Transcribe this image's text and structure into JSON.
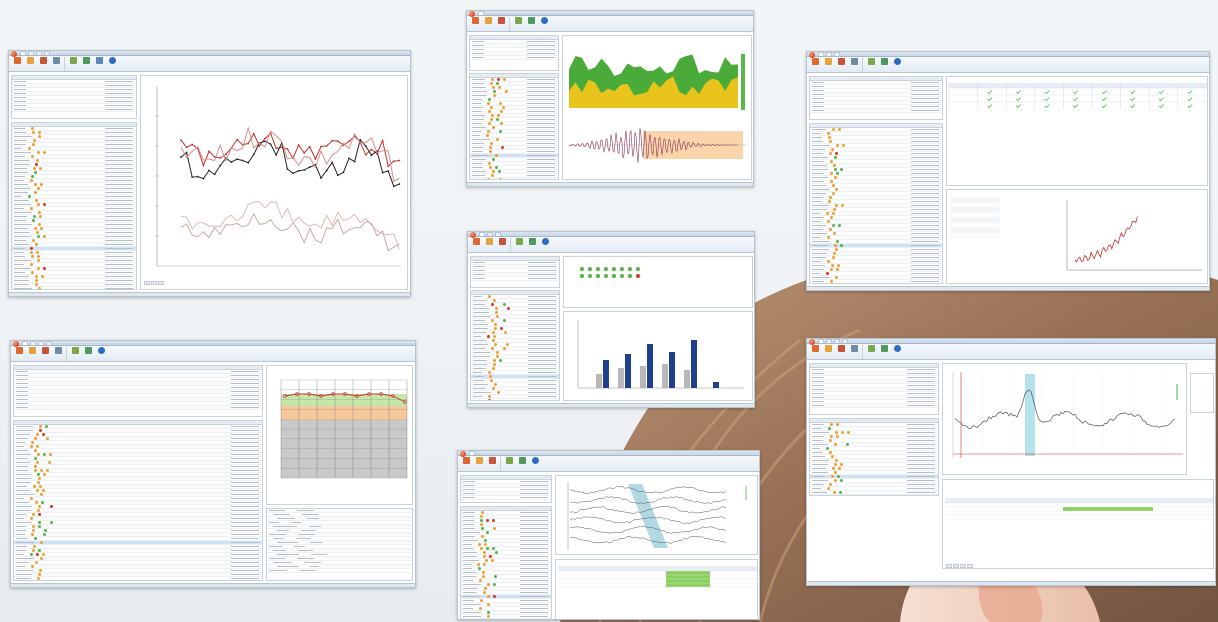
{
  "scene": {
    "background_colors": {
      "page": "#eef2f5",
      "hair": "#8a5a3a",
      "skin": "#f2d4c2"
    }
  },
  "windows": [
    {
      "id": "w1",
      "kind": "line-chart",
      "accent": "#c9302c"
    },
    {
      "id": "w2",
      "kind": "area-chart",
      "accent": "#e8c41c"
    },
    {
      "id": "w3",
      "kind": "table-chart",
      "accent": "#4a9b3c"
    },
    {
      "id": "w4",
      "kind": "audiogram",
      "accent": "#e58a3a"
    },
    {
      "id": "w5",
      "kind": "bar-chart",
      "accent": "#1f3f8f"
    },
    {
      "id": "w6",
      "kind": "waves",
      "accent": "#7fc0d0"
    },
    {
      "id": "w7",
      "kind": "waveform",
      "accent": "#80cde0"
    }
  ],
  "status_colors": {
    "orange": "#f0a030",
    "green": "#53b548",
    "red": "#d9362b"
  },
  "icons": [
    "app-orb-icon",
    "toolbar-new-icon",
    "toolbar-open-icon",
    "toolbar-save-icon",
    "toolbar-print-icon",
    "toolbar-help-icon"
  ]
}
